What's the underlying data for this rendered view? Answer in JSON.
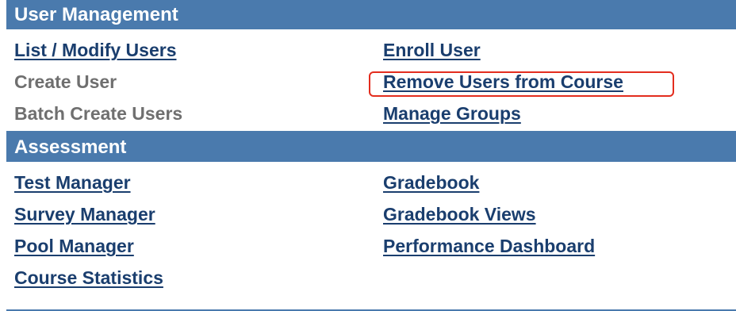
{
  "user_management": {
    "title": "User Management",
    "left_items": [
      {
        "label": "List / Modify Users",
        "enabled": true
      },
      {
        "label": "Create User",
        "enabled": false
      },
      {
        "label": "Batch Create Users",
        "enabled": false
      }
    ],
    "right_items": [
      {
        "label": "Enroll User",
        "enabled": true
      },
      {
        "label": "Remove Users from Course",
        "enabled": true,
        "highlighted": true
      },
      {
        "label": "Manage Groups",
        "enabled": true
      }
    ]
  },
  "assessment": {
    "title": "Assessment",
    "left_items": [
      {
        "label": "Test Manager",
        "enabled": true
      },
      {
        "label": "Survey Manager",
        "enabled": true
      },
      {
        "label": "Pool Manager",
        "enabled": true
      },
      {
        "label": "Course Statistics",
        "enabled": true
      }
    ],
    "right_items": [
      {
        "label": "Gradebook",
        "enabled": true
      },
      {
        "label": "Gradebook Views",
        "enabled": true
      },
      {
        "label": "Performance Dashboard",
        "enabled": true
      }
    ]
  },
  "colors": {
    "header_bg": "#4a7aad",
    "link": "#1a3e6e",
    "disabled_text": "#6f6f6f",
    "highlight_border": "#e32d1e"
  }
}
